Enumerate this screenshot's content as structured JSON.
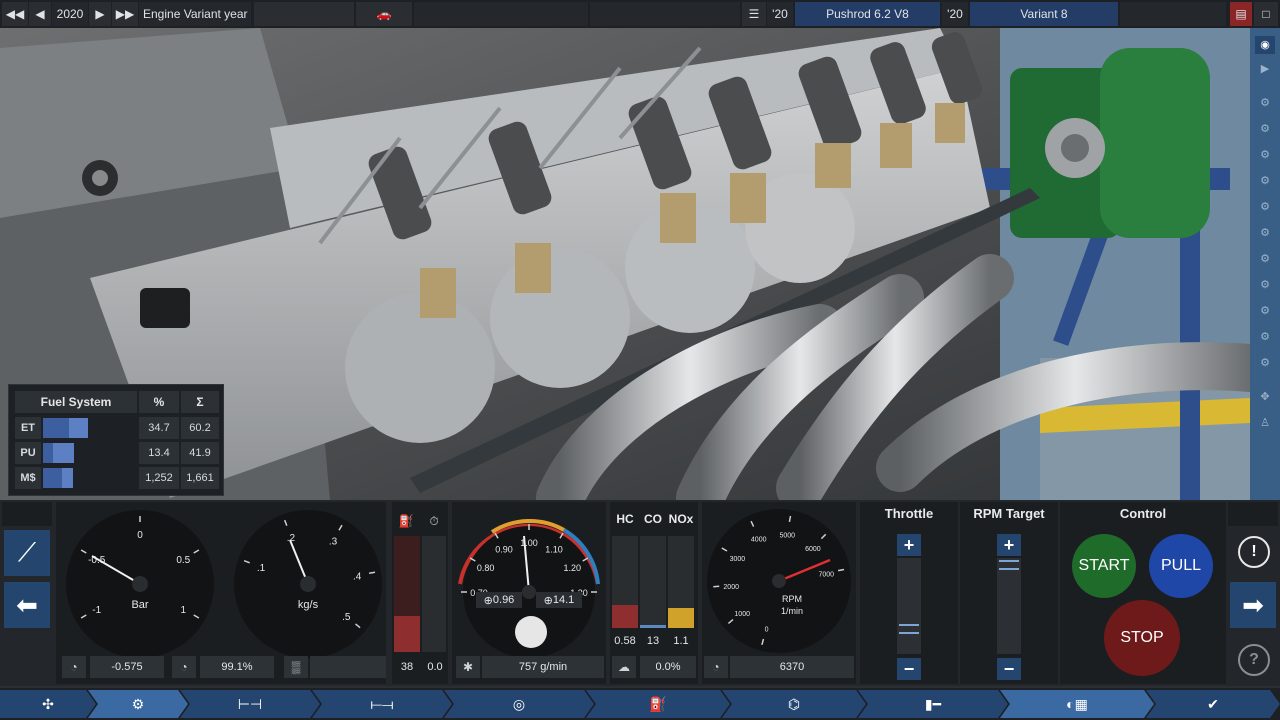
{
  "topbar": {
    "year": "2020",
    "label": "Engine Variant year",
    "family_year": "'20",
    "family_name": "Pushrod 6.2 V8",
    "variant_year": "'20",
    "variant_name": "Variant 8"
  },
  "fuel_table": {
    "title": "Fuel System",
    "col_pct": "%",
    "col_sum": "Σ",
    "rows": [
      {
        "label": "ET",
        "pct": "34.7",
        "sum": "60.2",
        "fill": 0.602,
        "fill_light": 0.347
      },
      {
        "label": "PU",
        "pct": "13.4",
        "sum": "41.9",
        "fill": 0.419,
        "fill_light": 0.134
      },
      {
        "label": "M$",
        "pct": "1,252",
        "sum": "1,661",
        "fill": 0.4,
        "fill_light": 0.25
      }
    ]
  },
  "gauges": {
    "boost": {
      "unit": "Bar",
      "ticks": [
        "-1",
        "-0.5",
        "0",
        "0.5",
        "1"
      ],
      "value": "-0.575"
    },
    "airflow": {
      "unit": "kg/s",
      "ticks": [
        ".1",
        ".2",
        ".3",
        ".4",
        ".5"
      ],
      "value": "99.1%"
    },
    "fuel_level": {
      "value_left": "38",
      "value_right": "0.0"
    },
    "afr": {
      "ticks": [
        "0.70",
        "0.80",
        "0.90",
        "1.00",
        "1.10",
        "1.20",
        "1.30"
      ],
      "val_left": "0.96",
      "val_right": "14.1",
      "flow": "757 g/min"
    },
    "emissions": {
      "labels": [
        "HC",
        "CO",
        "NOx"
      ],
      "values": [
        "0.58",
        "13",
        "1.1"
      ],
      "pct": "0.0%"
    },
    "rpm": {
      "unit": "RPM",
      "unit2": "1/min",
      "ticks": [
        "0",
        "1000",
        "2000",
        "3000",
        "4000",
        "5000",
        "6000",
        "7000"
      ],
      "value": "6370"
    }
  },
  "controls": {
    "throttle": "Throttle",
    "rpm_target": "RPM Target",
    "control": "Control",
    "start": "START",
    "pull": "PULL",
    "stop": "STOP",
    "plus": "+",
    "minus": "−"
  },
  "colors": {
    "accent": "#24456e",
    "start": "#1e6b2a",
    "pull": "#1e47a8",
    "stop": "#6e1a1a"
  }
}
